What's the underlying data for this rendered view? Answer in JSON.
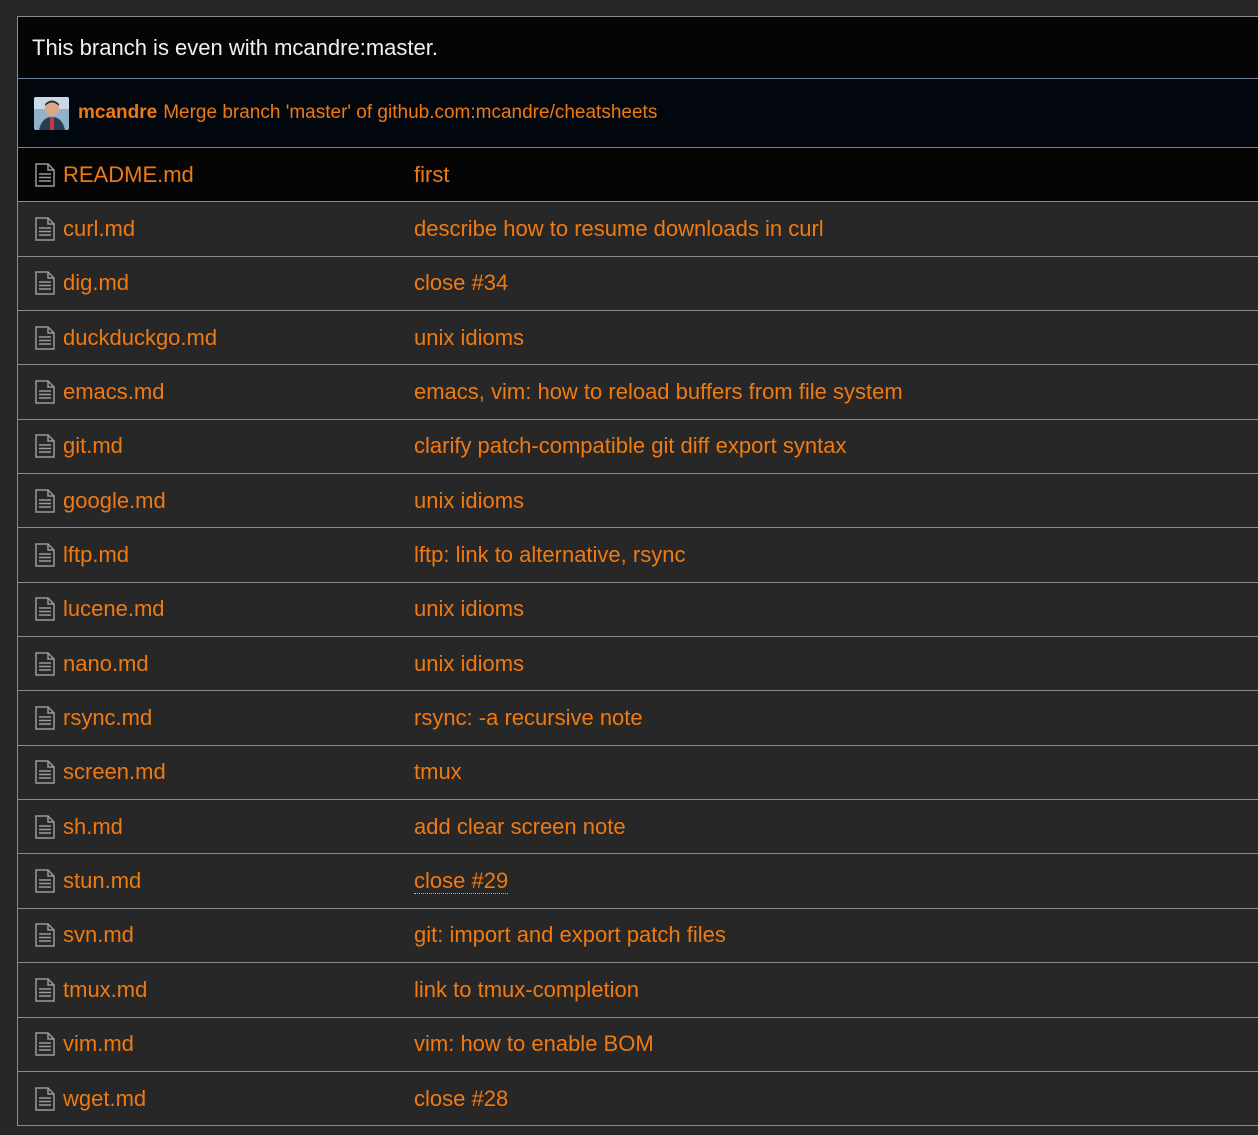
{
  "branch_status": "This branch is even with mcandre:master.",
  "latest_commit": {
    "author": "mcandre",
    "message": "Merge branch 'master' of github.com:mcandre/cheatsheets"
  },
  "files": [
    {
      "name": "README.md",
      "message": "first"
    },
    {
      "name": "curl.md",
      "message": "describe how to resume downloads in curl"
    },
    {
      "name": "dig.md",
      "message": "close #34"
    },
    {
      "name": "duckduckgo.md",
      "message": "unix idioms"
    },
    {
      "name": "emacs.md",
      "message": "emacs, vim: how to reload buffers from file system"
    },
    {
      "name": "git.md",
      "message": "clarify patch-compatible git diff export syntax"
    },
    {
      "name": "google.md",
      "message": "unix idioms"
    },
    {
      "name": "lftp.md",
      "message": "lftp: link to alternative, rsync"
    },
    {
      "name": "lucene.md",
      "message": "unix idioms"
    },
    {
      "name": "nano.md",
      "message": "unix idioms"
    },
    {
      "name": "rsync.md",
      "message": "rsync: -a recursive note"
    },
    {
      "name": "screen.md",
      "message": "tmux"
    },
    {
      "name": "sh.md",
      "message": "add clear screen note"
    },
    {
      "name": "stun.md",
      "message": "close #29"
    },
    {
      "name": "svn.md",
      "message": "git: import and export patch files"
    },
    {
      "name": "tmux.md",
      "message": "link to tmux-completion"
    },
    {
      "name": "vim.md",
      "message": "vim: how to enable BOM"
    },
    {
      "name": "wget.md",
      "message": "close #28"
    }
  ],
  "colors": {
    "link": "#f07a12",
    "background": "#272727",
    "header_background": "#050505",
    "border": "#8a8a8a"
  },
  "icons": {
    "file": "file-text-icon",
    "avatar": "user-avatar"
  }
}
